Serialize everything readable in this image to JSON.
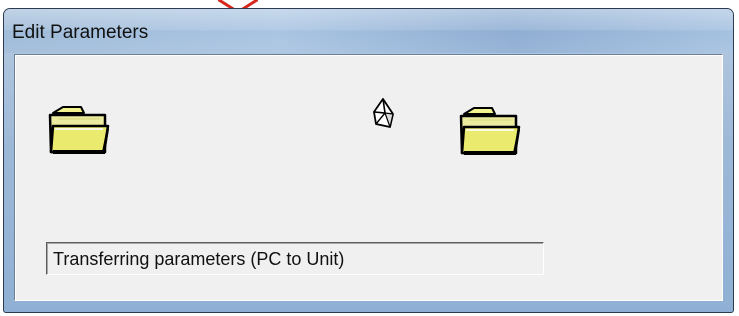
{
  "window": {
    "title": "Edit Parameters"
  },
  "status": {
    "text": "Transferring parameters (PC to Unit)"
  },
  "icons": {
    "left_folder": "folder-icon",
    "transfer_packet": "document-transfer-icon",
    "right_folder": "folder-icon"
  },
  "colors": {
    "title_bar": "#9fbbd9",
    "client_area": "#f0f0f0",
    "folder": "#eaea6f",
    "status_border": "#5d5d5d",
    "top_accent": "#d8261d"
  }
}
